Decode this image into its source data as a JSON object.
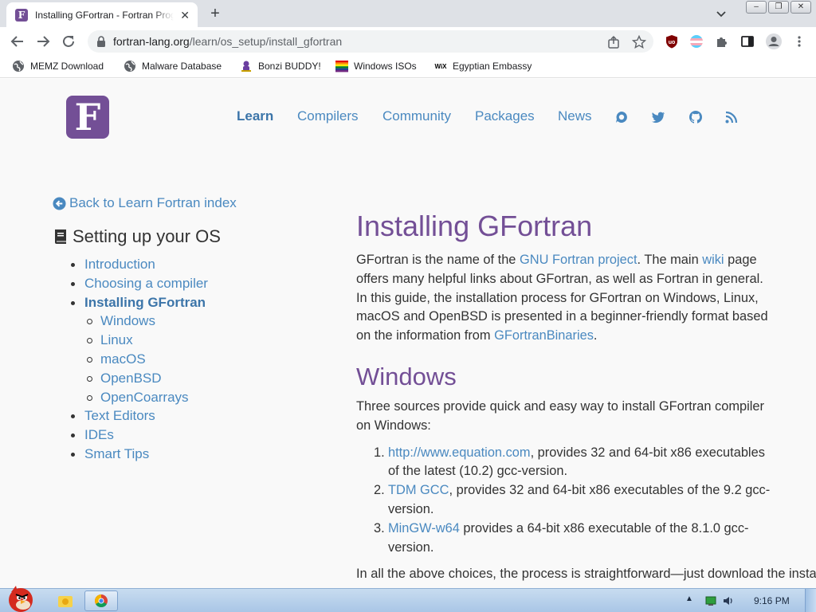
{
  "browser": {
    "tab_title": "Installing GFortran - Fortran Programming Language",
    "tab_favicon_letter": "F",
    "url_host": "fortran-lang.org",
    "url_path": "/learn/os_setup/install_gfortran",
    "win_ctrls": [
      "–",
      "❐",
      "✕"
    ],
    "bookmarks": [
      {
        "label": "MEMZ Download",
        "icon": "globe-icon"
      },
      {
        "label": "Malware Database",
        "icon": "globe-icon"
      },
      {
        "label": "Bonzi BUDDY!",
        "icon": "bonzi-icon"
      },
      {
        "label": "Windows ISOs",
        "icon": "windows-flag-icon"
      },
      {
        "label": "Egyptian Embassy",
        "icon": "wix-icon"
      }
    ]
  },
  "site": {
    "logo_letter": "F",
    "nav": [
      {
        "label": "Learn",
        "active": true
      },
      {
        "label": "Compilers"
      },
      {
        "label": "Community"
      },
      {
        "label": "Packages"
      },
      {
        "label": "News"
      }
    ],
    "nav_icons": [
      "discourse-icon",
      "twitter-icon",
      "github-icon",
      "rss-icon"
    ]
  },
  "sidebar": {
    "back_link": "Back to Learn Fortran index",
    "heading": "Setting up your OS",
    "items": [
      {
        "label": "Introduction"
      },
      {
        "label": "Choosing a compiler"
      },
      {
        "label": "Installing GFortran",
        "active": true
      },
      {
        "label": "Windows",
        "sub": true
      },
      {
        "label": "Linux",
        "sub": true
      },
      {
        "label": "macOS",
        "sub": true
      },
      {
        "label": "OpenBSD",
        "sub": true
      },
      {
        "label": "OpenCoarrays",
        "sub": true
      },
      {
        "label": "Text Editors"
      },
      {
        "label": "IDEs"
      },
      {
        "label": "Smart Tips"
      }
    ]
  },
  "content": {
    "title": "Installing GFortran",
    "intro": {
      "t1": "GFortran is the name of the ",
      "l1": "GNU Fortran project",
      "t2": ". The main ",
      "l2": "wiki",
      "t3": " page offers many helpful links about GFortran, as well as Fortran in general. In this guide, the installation process for GFortran on Windows, Linux, macOS and OpenBSD is presented in a beginner-friendly format based on the information from ",
      "l3": "GFortranBinaries",
      "t4": "."
    },
    "windows_heading": "Windows",
    "windows_intro": "Three sources provide quick and easy way to install GFortran compiler on Windows:",
    "sources": [
      {
        "num": "1.",
        "link": "http://www.equation.com",
        "text": ", provides 32 and 64-bit x86 executables of the latest (10.2) gcc-version."
      },
      {
        "num": "2.",
        "link": "TDM GCC",
        "text": ", provides 32 and 64-bit x86 executables of the 9.2 gcc-version."
      },
      {
        "num": "3.",
        "link": "MinGW-w64",
        "text": " provides a 64-bit x86 executable of the 8.1.0 gcc-version."
      }
    ],
    "closing": "In all the above choices, the process is straightforward—just download the installer and follow the installation wizard."
  },
  "taskbar": {
    "clock": "9:16 PM"
  },
  "colors": {
    "accent": "#734f96",
    "link": "#4a89c0",
    "text": "#333333",
    "page_bg": "#f9f9f9"
  }
}
